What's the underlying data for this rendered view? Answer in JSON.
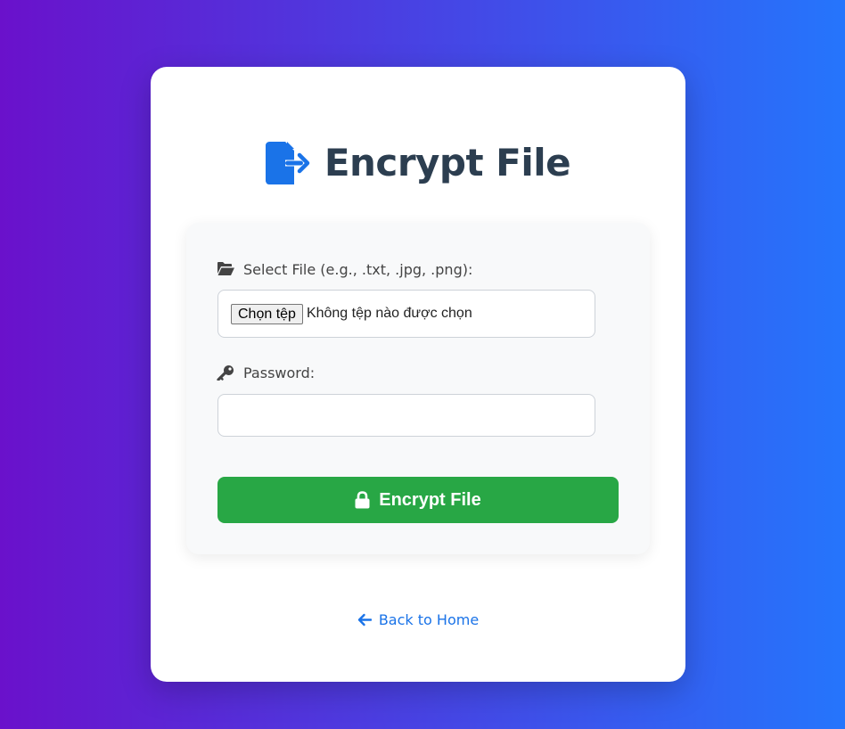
{
  "page": {
    "title": "Encrypt File",
    "title_icon": "file-export-icon"
  },
  "form": {
    "file_label": "Select File (e.g., .txt, .jpg, .png):",
    "file_label_icon": "folder-open-icon",
    "file_button_label": "Chọn tệp",
    "file_status": "Không tệp nào được chọn",
    "password_label": "Password:",
    "password_label_icon": "key-icon",
    "password_value": "",
    "submit_label": "Encrypt File",
    "submit_icon": "lock-icon"
  },
  "footer": {
    "back_label": "Back to Home",
    "back_icon": "arrow-left-icon"
  },
  "colors": {
    "background_start": "#6a11cb",
    "background_end": "#2575fc",
    "title": "#2c3e50",
    "accent_blue": "#1a73e8",
    "submit_green": "#28a745"
  }
}
